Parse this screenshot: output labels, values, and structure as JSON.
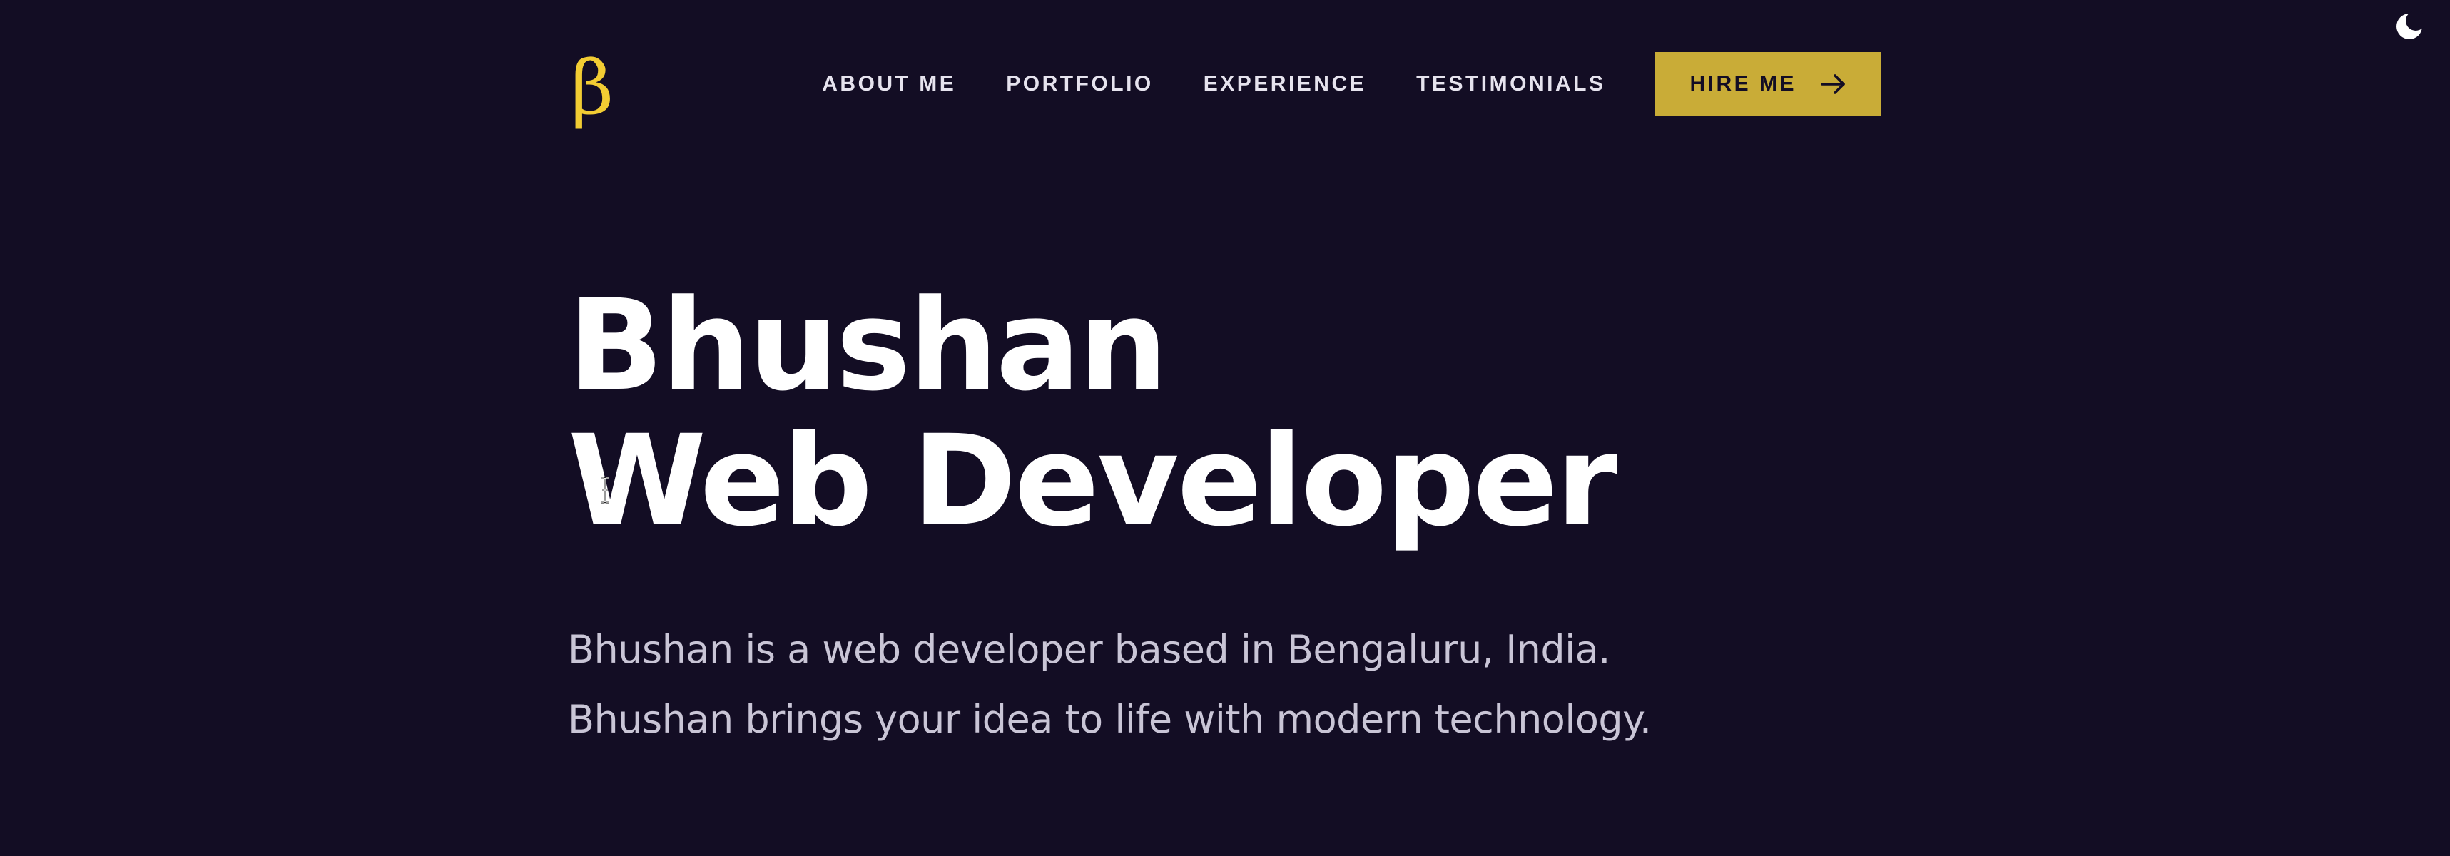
{
  "colors": {
    "background": "#130d24",
    "accent": "#f2cc33",
    "button_bg": "#c9ac37",
    "heading": "#ffffff",
    "body_text": "#c9c5d6"
  },
  "header": {
    "logo": "β",
    "theme_toggle_icon": "moon-icon",
    "nav": [
      {
        "label": "ABOUT ME"
      },
      {
        "label": "PORTFOLIO"
      },
      {
        "label": "EXPERIENCE"
      },
      {
        "label": "TESTIMONIALS"
      }
    ],
    "hire_button": {
      "label": "HIRE ME",
      "icon": "arrow-right-icon"
    }
  },
  "hero": {
    "title_line1": "Bhushan",
    "title_line2": "Web Developer",
    "description_line1": "Bhushan is a web developer based in Bengaluru, India.",
    "description_line2": "Bhushan brings your idea to life with modern technology."
  }
}
